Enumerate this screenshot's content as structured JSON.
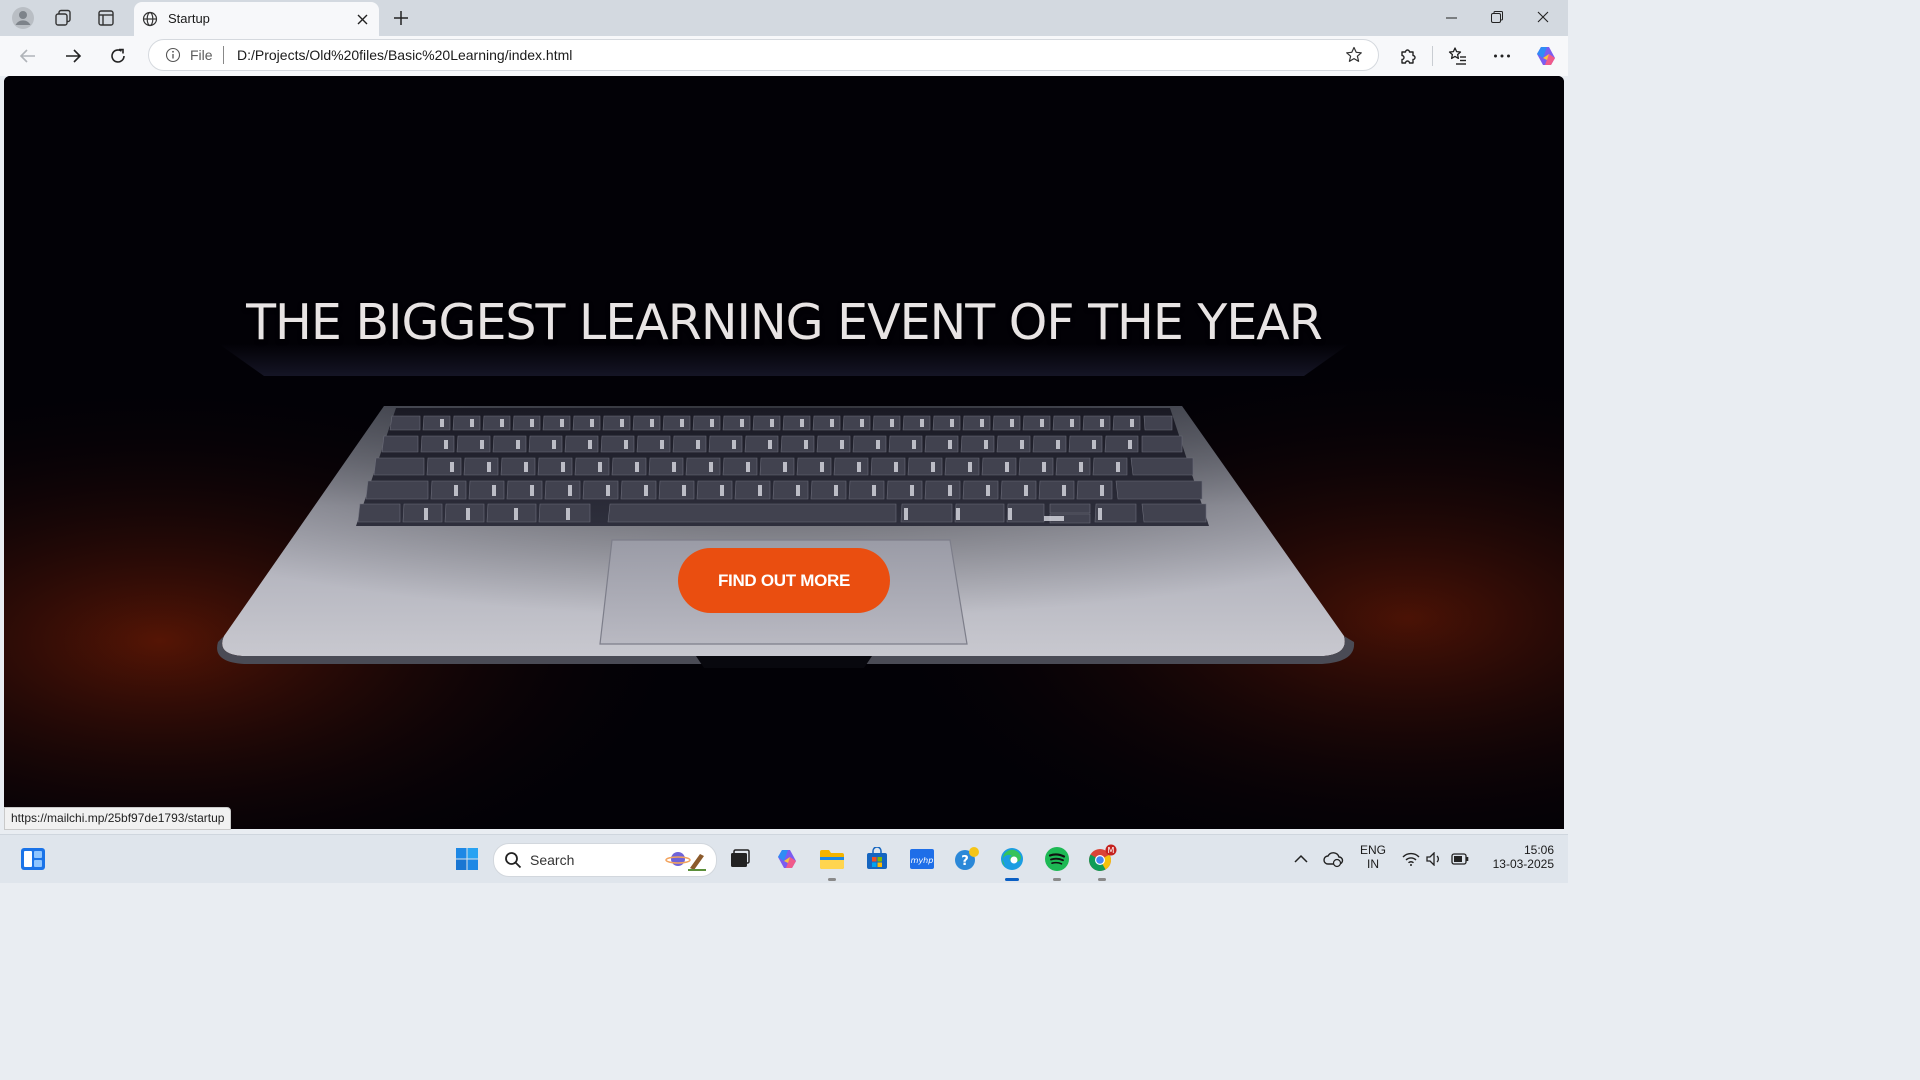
{
  "browser": {
    "tab": {
      "title": "Startup",
      "close_icon": "close-icon"
    },
    "address_bar": {
      "scheme_label": "File",
      "url": "D:/Projects/Old%20files/Basic%20Learning/index.html"
    },
    "status_link": "https://mailchi.mp/25bf97de1793/startup"
  },
  "page": {
    "hero": {
      "heading": "THE BIGGEST LEARNING EVENT OF THE YEAR",
      "cta_label": "FIND OUT MORE",
      "cta_color": "#ea4e10"
    }
  },
  "taskbar": {
    "search_label": "Search",
    "tray": {
      "lang_line1": "ENG",
      "lang_line2": "IN",
      "time": "15:06",
      "date": "13-03-2025"
    },
    "chrome_badge": "M"
  }
}
